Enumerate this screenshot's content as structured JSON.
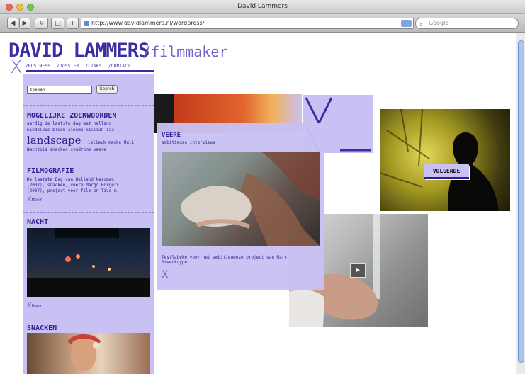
{
  "window": {
    "title": "David Lammers"
  },
  "toolbar": {
    "url": "http://www.davidlammers.nl/wordpress/",
    "search_placeholder": "Google"
  },
  "site": {
    "title": "DAVID LAMMERS",
    "subtitle": "/filmmaker",
    "logo": "X",
    "nav": [
      "/BUSINESS",
      "/DOSSIER",
      "/LINKS",
      "/CONTACT"
    ]
  },
  "sidebar": {
    "search_value": "zoeken",
    "search_button": "Search",
    "tags_heading": "MOGELIJKE ZOEKWOORDEN",
    "tags_line1": "aardig de laatste dag met helland",
    "tags_line2": "Eindeloos bloem cinema killian iaa",
    "tags_big": "landscape",
    "tags_big_suffix": "lelieuk mauke Muli",
    "tags_line3": "Nachtbis snacken syndrome veere",
    "filmografie_heading": "FILMOGRAFIE",
    "filmografie_text1": "De laatste Dag van Helland Nasomen",
    "filmografie_text2": "(2007), snacken, veere Margo Borgers",
    "filmografie_text3": "(2007), project voor film en live m...",
    "meer": "Meer",
    "nacht_heading": "NACHT",
    "nacht_meer": "Meer",
    "snacken_heading": "SNACKEN"
  },
  "feature": {
    "title": "VEERE",
    "subtitle": "ambitieuze interviews",
    "description1": "Testlabeke voor het ambitieuense project van Marc",
    "description2": "Steenkuyper.",
    "x": "X"
  },
  "next_button": "VOLGENDE",
  "colors": {
    "accent": "#3a2ea3",
    "panel": "#c9c1f3"
  },
  "icons": [
    "back-icon",
    "forward-icon",
    "reload-icon",
    "add-icon",
    "globe-icon",
    "rss-icon",
    "search-icon",
    "play-icon"
  ]
}
